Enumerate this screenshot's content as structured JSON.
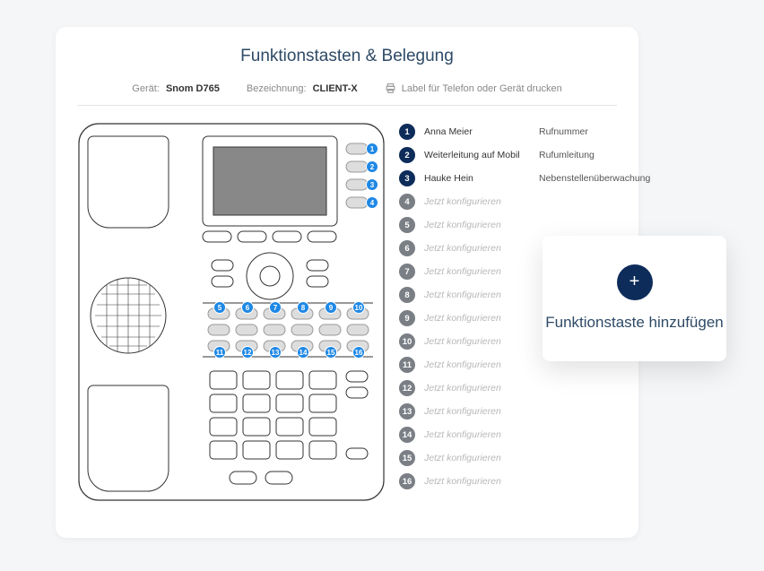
{
  "title": "Funktionstasten & Belegung",
  "info": {
    "device_label": "Gerät:",
    "device_value": "Snom D765",
    "name_label": "Bezeichnung:",
    "name_value": "CLIENT-X",
    "print_label": "Label für Telefon oder Gerät drucken"
  },
  "placeholder_text": "Jetzt konfigurieren",
  "keys": [
    {
      "n": 1,
      "label": "Anna Meier",
      "type": "Rufnummer",
      "configured": true
    },
    {
      "n": 2,
      "label": "Weiterleitung auf Mobil",
      "type": "Rufumleitung",
      "configured": true
    },
    {
      "n": 3,
      "label": "Hauke Hein",
      "type": "Nebenstellenüberwachung",
      "configured": true
    },
    {
      "n": 4,
      "label": "",
      "type": "",
      "configured": false
    },
    {
      "n": 5,
      "label": "",
      "type": "",
      "configured": false
    },
    {
      "n": 6,
      "label": "",
      "type": "",
      "configured": false
    },
    {
      "n": 7,
      "label": "",
      "type": "",
      "configured": false
    },
    {
      "n": 8,
      "label": "",
      "type": "",
      "configured": false
    },
    {
      "n": 9,
      "label": "",
      "type": "",
      "configured": false
    },
    {
      "n": 10,
      "label": "",
      "type": "",
      "configured": false
    },
    {
      "n": 11,
      "label": "",
      "type": "",
      "configured": false
    },
    {
      "n": 12,
      "label": "",
      "type": "",
      "configured": false
    },
    {
      "n": 13,
      "label": "",
      "type": "",
      "configured": false
    },
    {
      "n": 14,
      "label": "",
      "type": "",
      "configured": false
    },
    {
      "n": 15,
      "label": "",
      "type": "",
      "configured": false
    },
    {
      "n": 16,
      "label": "",
      "type": "",
      "configured": false
    }
  ],
  "diagram_badges": {
    "side": [
      1,
      2,
      3,
      4
    ],
    "row_a": [
      5,
      6,
      7,
      8,
      9,
      10
    ],
    "row_b": [
      11,
      12,
      13,
      14,
      15,
      16
    ]
  },
  "add_card": {
    "label": "Funktionstaste hinzufügen"
  }
}
